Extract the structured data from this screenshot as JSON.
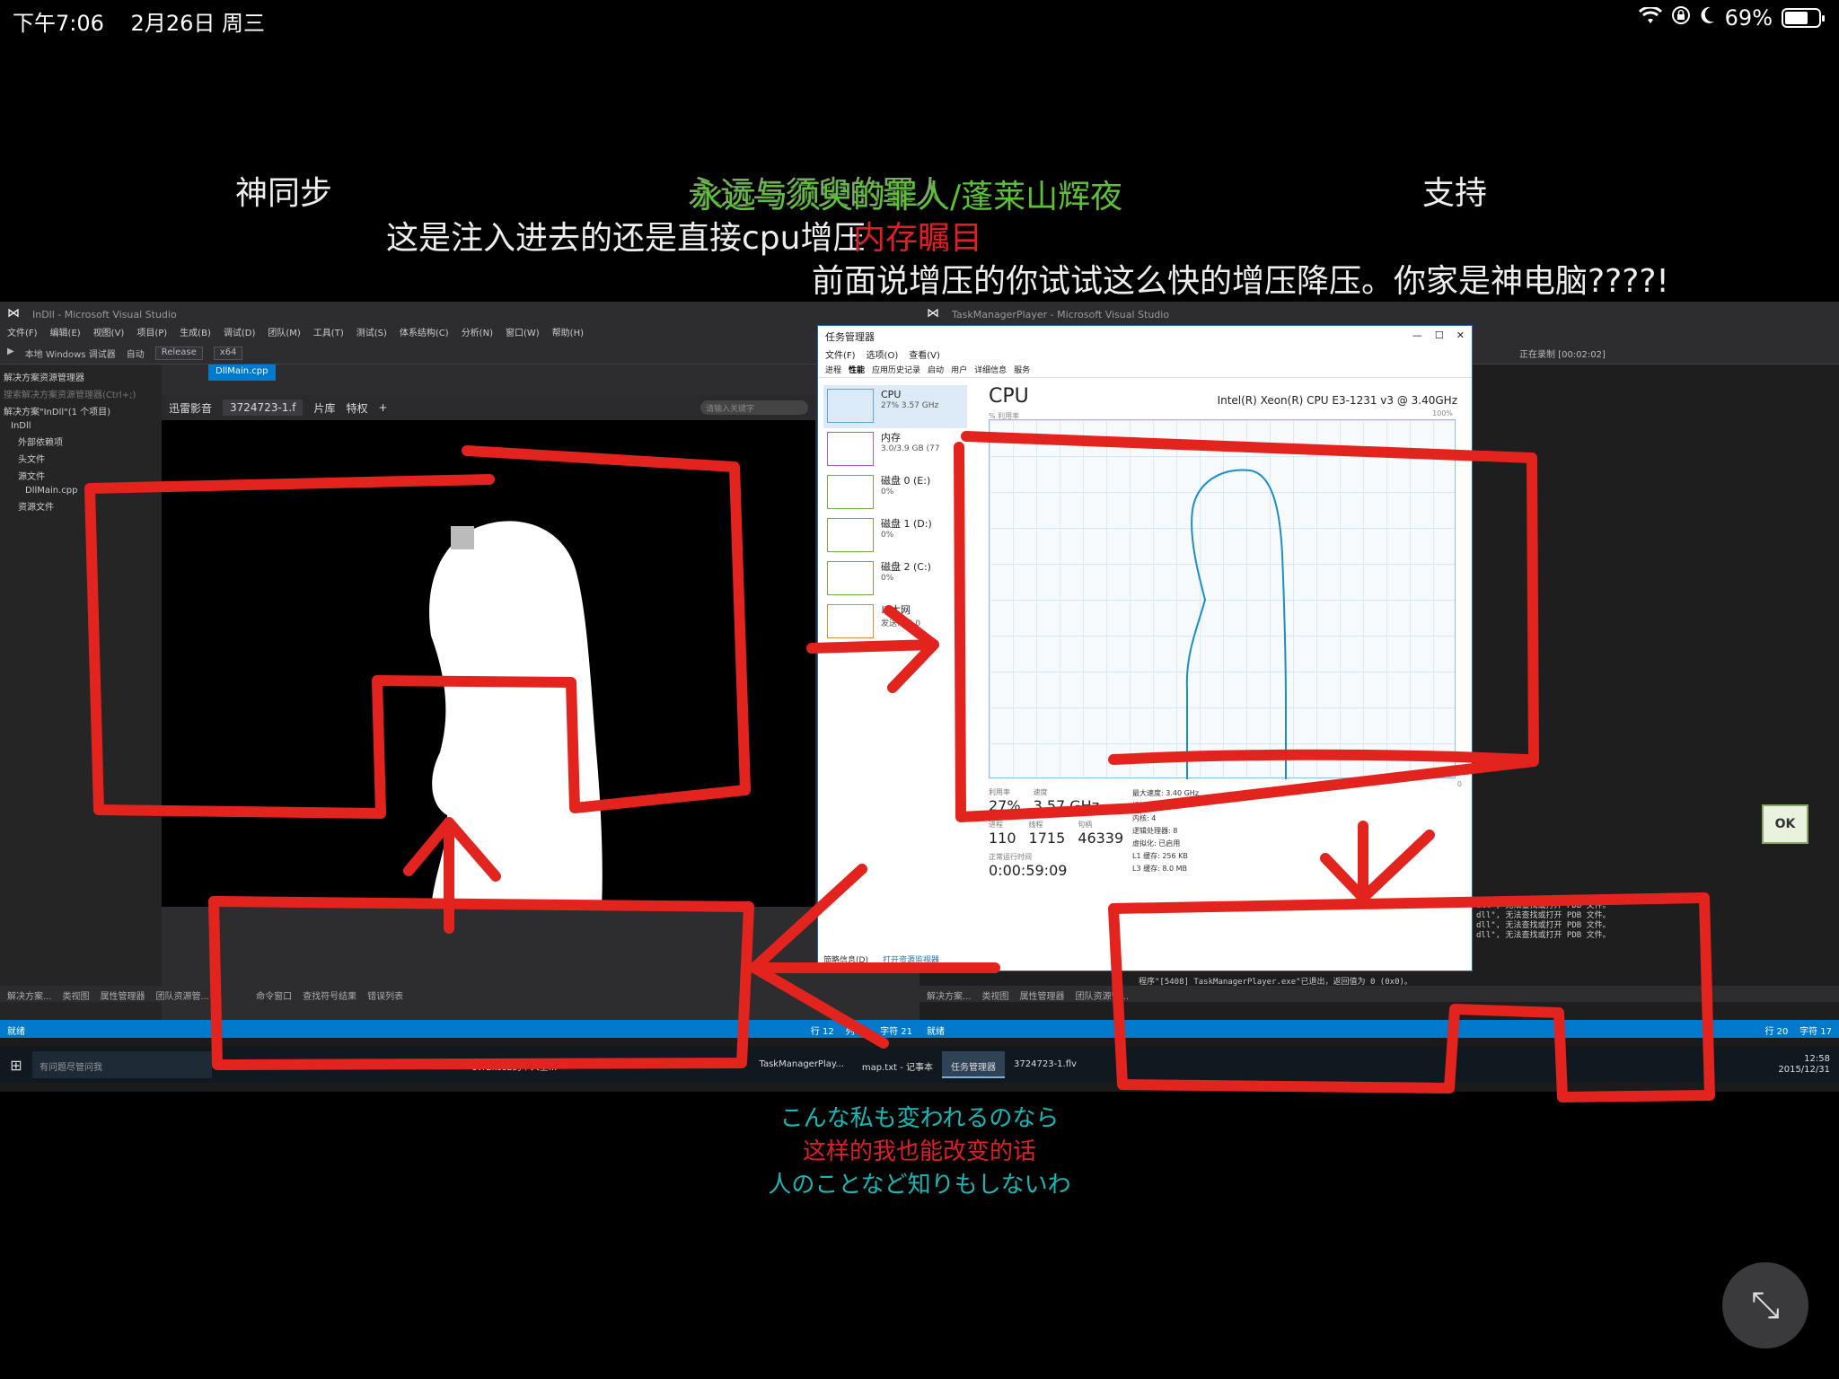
{
  "status_bar": {
    "time": "下午7:06",
    "date": "2月26日 周三",
    "battery": "69%",
    "battery_level": 0.69
  },
  "danmaku": {
    "d1": "神同步",
    "d2": "永远与须臾的罪人/蓬莱山辉夜",
    "d2b": "永远与须臾的罪人",
    "d3": "支持",
    "d4": "这是注入进去的还是直接cpu增压",
    "d5": "内存瞩目",
    "d6": "前面说增压的你试试这么快的增压降压。你家是神电脑????!"
  },
  "vs_left": {
    "title": "InDll - Microsoft Visual Studio",
    "menu": [
      "文件(F)",
      "编辑(E)",
      "视图(V)",
      "项目(P)",
      "生成(B)",
      "调试(D)",
      "团队(M)",
      "工具(T)",
      "测试(S)",
      "体系结构(C)",
      "分析(N)",
      "窗口(W)",
      "帮助(H)"
    ],
    "debugger": "本地 Windows 调试器",
    "auto": "自动",
    "config": "Release",
    "platform": "x64",
    "doc_tab": "DllMain.cpp",
    "solution_header": "解决方案资源管理器",
    "solution_search": "搜索解决方案资源管理器(Ctrl+;)",
    "tree": [
      "解决方案\"InDll\"(1 个项目)",
      "InDll",
      "外部依赖项",
      "头文件",
      "源文件",
      "DllMain.cpp",
      "资源文件"
    ],
    "bottom_tabs": [
      "解决方案...",
      "类视图",
      "属性管理器",
      "团队资源管..."
    ],
    "output_tabs": [
      "命令窗口",
      "查找符号结果",
      "错误列表"
    ],
    "status": "就绪",
    "line": "行 12",
    "col": "列 21",
    "ch": "字符 21"
  },
  "player": {
    "brand": "迅雷影音",
    "file_tab": "3724723-1.f",
    "tabs": [
      "片库",
      "特权"
    ],
    "search_placeholder": "请输入关键字"
  },
  "vs_right": {
    "title": "TaskManagerPlayer - Microsoft Visual Studio",
    "recording": "正在录制 [00:02:02]",
    "output_lines": [
      "dll\", 无法查找或打开 PDB 文件。",
      "dll\", 无法查找或打开 PDB 文件。",
      "dll\", 无法查找或打开 PDB 文件。",
      "dll\", 无法查找或打开 PDB 文件。"
    ],
    "exit_line": "程序\"[5408] TaskManagerPlayer.exe\"已退出，返回值为 0 (0x0)。",
    "status": "就绪",
    "line": "行 20",
    "ch": "字符 17",
    "bottom_tabs": [
      "解决方案...",
      "类视图",
      "属性管理器",
      "团队资源管..."
    ]
  },
  "taskmgr": {
    "title": "任务管理器",
    "menu": [
      "文件(F)",
      "选项(O)",
      "查看(V)"
    ],
    "tabs": [
      "进程",
      "性能",
      "应用历史记录",
      "启动",
      "用户",
      "详细信息",
      "服务"
    ],
    "side": [
      {
        "label": "CPU",
        "sub": "27% 3.57 GHz",
        "kind": ""
      },
      {
        "label": "内存",
        "sub": "3.0/3.9 GB (77",
        "kind": "mem"
      },
      {
        "label": "磁盘 0 (E:)",
        "sub": "0%",
        "kind": "disk"
      },
      {
        "label": "磁盘 1 (D:)",
        "sub": "0%",
        "kind": "disk"
      },
      {
        "label": "磁盘 2 (C:)",
        "sub": "0%",
        "kind": "disk"
      },
      {
        "label": "以太网",
        "sub": "发送: 16.0",
        "kind": "net"
      }
    ],
    "cpu_title": "CPU",
    "cpu_name": "Intel(R) Xeon(R) CPU E3-1231 v3 @ 3.40GHz",
    "graph_label": "% 利用率",
    "graph_max": "100%",
    "graph_min": "0",
    "util_label": "利用率",
    "util": "27%",
    "speed_label": "速度",
    "speed": "3.57 GHz",
    "proc_label": "进程",
    "proc": "110",
    "thread_label": "线程",
    "threads": "1715",
    "handle_label": "句柄",
    "handles": "46339",
    "uptime_label": "正常运行时间",
    "uptime": "0:00:59:09",
    "specs": [
      {
        "k": "最大速度:",
        "v": "3.40 GHz"
      },
      {
        "k": "插槽:",
        "v": "1"
      },
      {
        "k": "内核:",
        "v": "4"
      },
      {
        "k": "逻辑处理器:",
        "v": "8"
      },
      {
        "k": "虚拟化:",
        "v": "已启用"
      },
      {
        "k": "L1 缓存:",
        "v": "256 KB"
      },
      {
        "k": "L3 缓存:",
        "v": "8.0 MB"
      }
    ],
    "footer_brief": "简略信息(D)",
    "footer_link": "打开资源监视器"
  },
  "taskbar": {
    "search": "有问题尽管问我",
    "apps": [
      "svr2kos2的个人空...",
      "Player",
      "Capt",
      "InDll - Microsoft ...",
      "TaskManagerPlay...",
      "map.txt - 记事本",
      "任务管理器",
      "3724723-1.flv"
    ],
    "time": "12:58",
    "date": "2015/12/31"
  },
  "ok_label": "OK",
  "subtitles": {
    "jp1": "こんな私も変われるのなら",
    "cn": "这样的我也能改变的话",
    "jp2": "人のことなど知りもしないわ"
  },
  "colors": {
    "ink": "#e3241e",
    "vs_blue": "#007acc"
  },
  "icons": [
    "wifi-icon",
    "lock-rotation-icon",
    "moon-icon",
    "battery-icon",
    "minimize-fullscreen-icon"
  ]
}
